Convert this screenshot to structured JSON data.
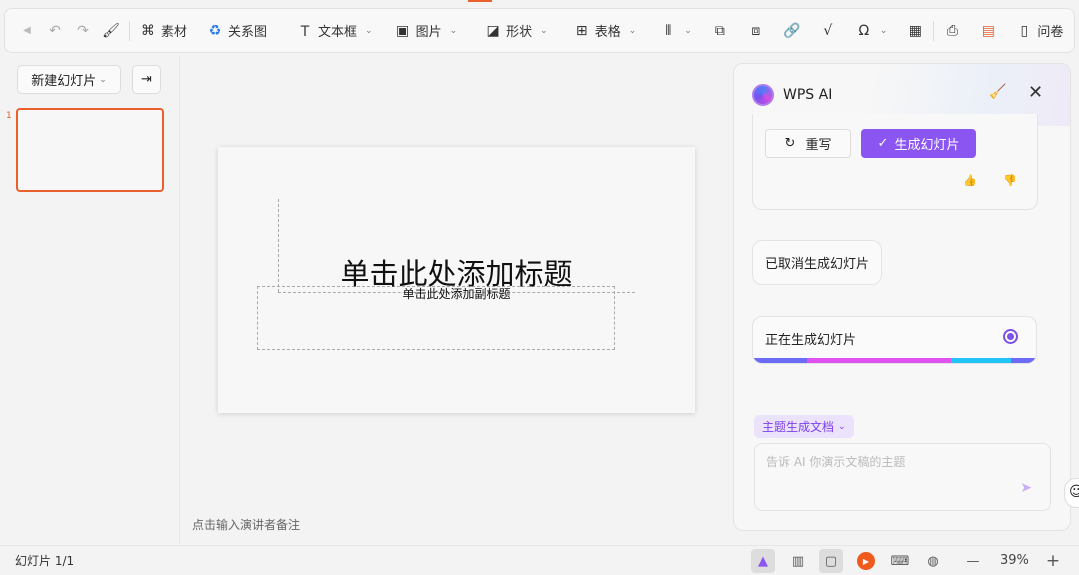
{
  "toolbar": {
    "items": [
      {
        "label": "素材",
        "icon": "material-icon"
      },
      {
        "label": "关系图",
        "icon": "relation-icon"
      },
      {
        "label": "文本框",
        "icon": "textbox-icon"
      },
      {
        "label": "图片",
        "icon": "image-icon"
      },
      {
        "label": "形状",
        "icon": "shape-icon"
      },
      {
        "label": "表格",
        "icon": "table-icon"
      }
    ],
    "survey": "问卷"
  },
  "left": {
    "new_slide": "新建幻灯片",
    "thumb_number": "1"
  },
  "slide": {
    "title": "单击此处添加标题",
    "subtitle": "单击此处添加副标题"
  },
  "notes": "点击输入演讲者备注",
  "status": {
    "slide_count": "幻灯片 1/1",
    "zoom": "39%"
  },
  "ai": {
    "title": "WPS AI",
    "rewrite": "重写",
    "generate": "生成幻灯片",
    "cancelled": "已取消生成幻灯片",
    "generating": "正在生成幻灯片",
    "mode": "主题生成文档",
    "placeholder": "告诉 AI 你演示文稿的主题",
    "progress_colors": [
      "#6b6bf5",
      "#e052f0",
      "#22c3f5",
      "#6b6bf5"
    ],
    "accent": "#8a55f0"
  }
}
